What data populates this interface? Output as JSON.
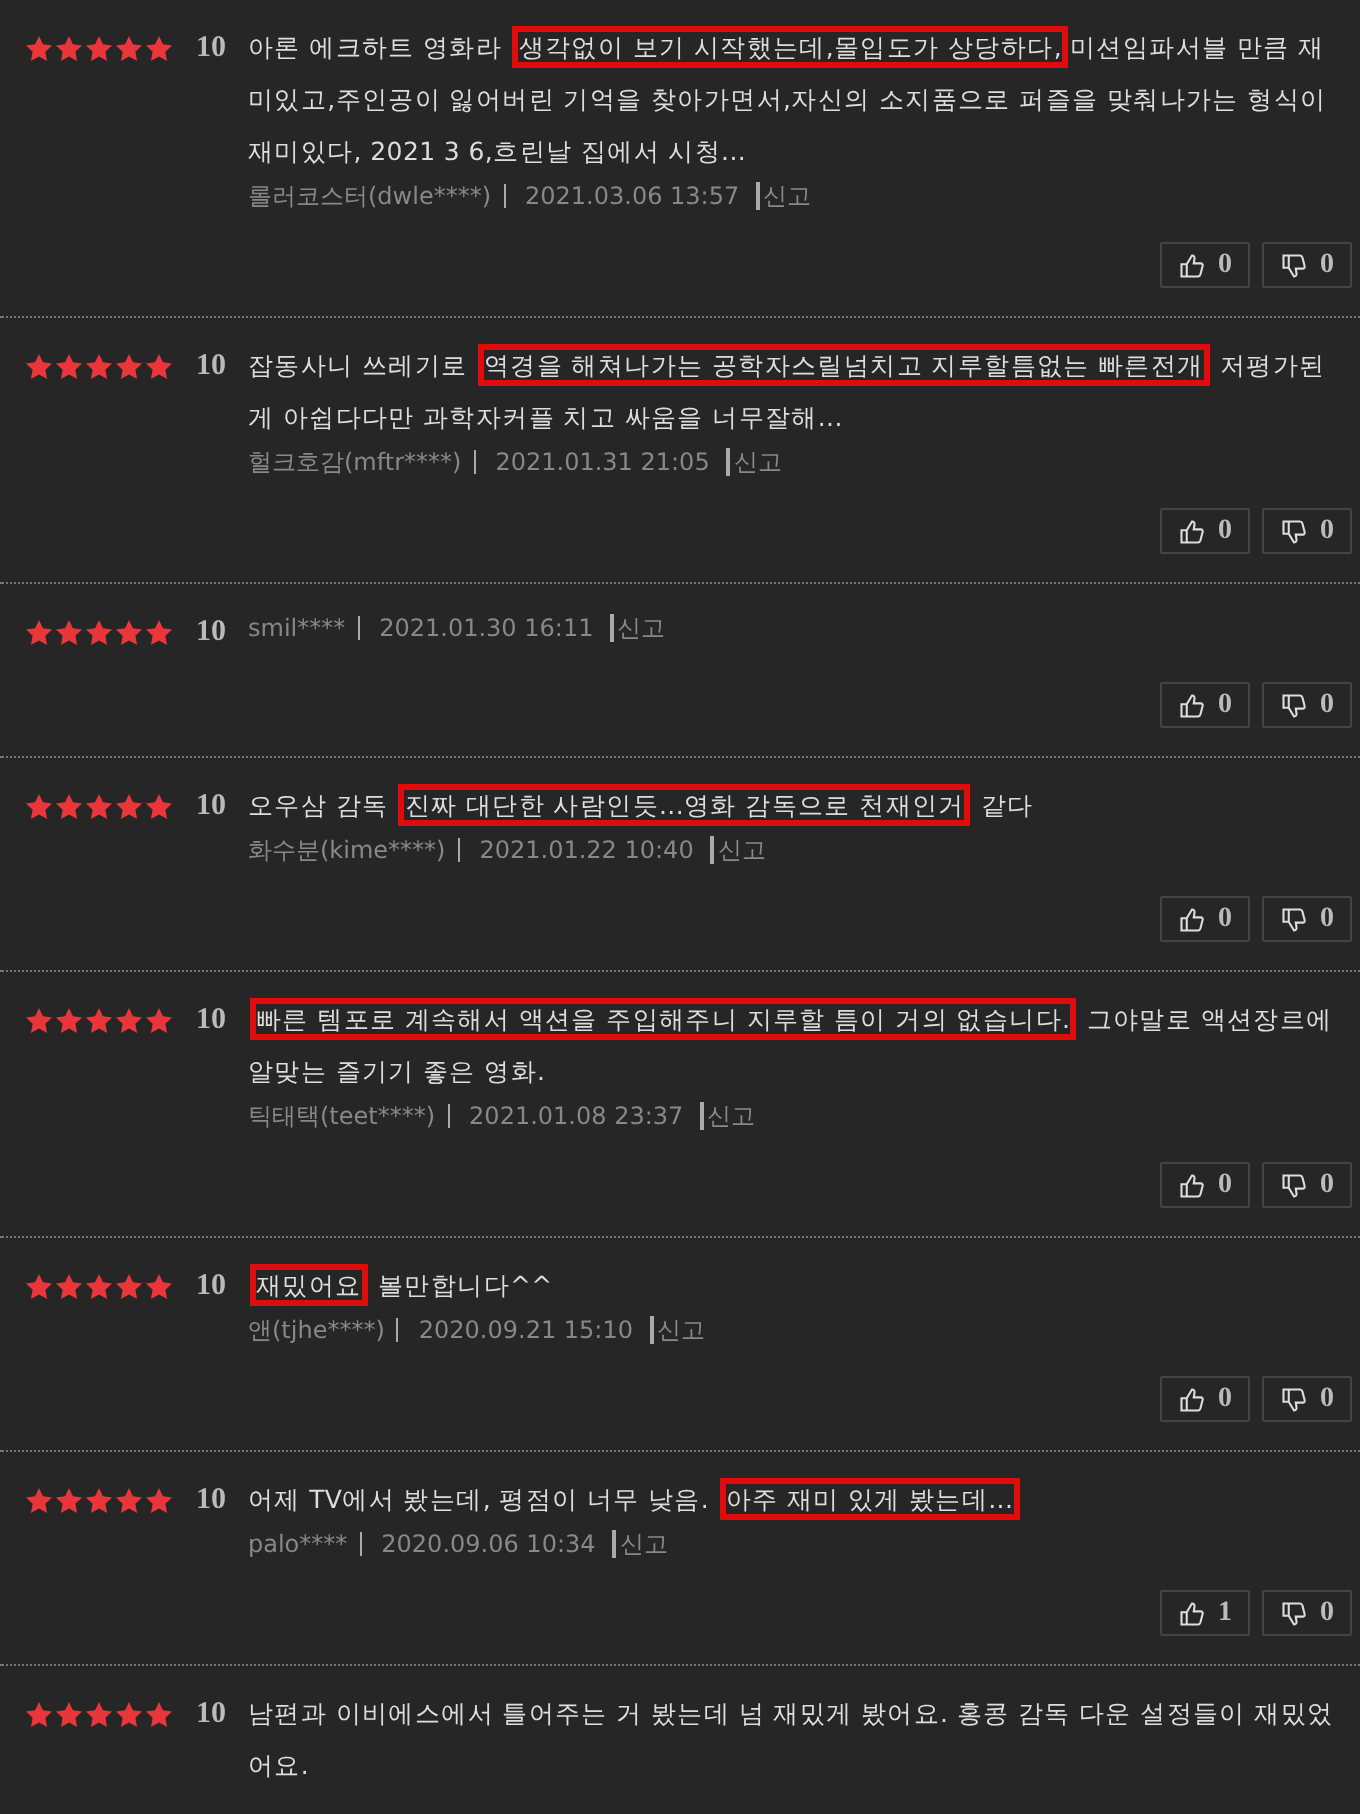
{
  "reviews": [
    {
      "stars": 5,
      "score": "10",
      "segments": [
        {
          "text": "아론 에크하트 영화라 ",
          "highlighted": false
        },
        {
          "text": "생각없이 보기 시작했는데,몰입도가 상당하다,",
          "highlighted": true
        },
        {
          "text": "미션임파서블 만큼 재미있고,주인공이 잃어버린 기억을 찾아가면서,자신의 소지품으로 퍼즐을 맞춰나가는 형식이 재미있다, 2021 3 6,흐린날 집에서 시청...",
          "highlighted": false
        }
      ],
      "author": "롤러코스터(dwle****)",
      "date": "2021.03.06 13:57",
      "report": "신고",
      "likes": "0",
      "dislikes": "0"
    },
    {
      "stars": 5,
      "score": "10",
      "segments": [
        {
          "text": "잡동사니 쓰레기로 ",
          "highlighted": false
        },
        {
          "text": "역경을 해쳐나가는 공학자스릴넘치고 지루할틈없는 빠른전개",
          "highlighted": true
        },
        {
          "text": " 저평가된게 아쉽다다만 과학자커플 치고 싸움을 너무잘해...",
          "highlighted": false
        }
      ],
      "author": "헐크호감(mftr****)",
      "date": "2021.01.31 21:05",
      "report": "신고",
      "likes": "0",
      "dislikes": "0"
    },
    {
      "stars": 5,
      "score": "10",
      "author": "smil****",
      "date": "2021.01.30 16:11",
      "report": "신고",
      "likes": "0",
      "dislikes": "0"
    },
    {
      "stars": 5,
      "score": "10",
      "segments": [
        {
          "text": "오우삼 감독 ",
          "highlighted": false
        },
        {
          "text": "진짜 대단한 사람인듯...영화 감독으로 천재인거",
          "highlighted": true
        },
        {
          "text": " 같다",
          "highlighted": false
        }
      ],
      "author": "화수분(kime****)",
      "date": "2021.01.22 10:40",
      "report": "신고",
      "likes": "0",
      "dislikes": "0"
    },
    {
      "stars": 5,
      "score": "10",
      "segments": [
        {
          "text": "빠른 템포로 계속해서 액션을 주입해주니 지루할 틈이 거의 없습니다.",
          "highlighted": true
        },
        {
          "text": " 그야말로 액션장르에 알맞는 즐기기 좋은 영화.",
          "highlighted": false
        }
      ],
      "author": "틱태택(teet****)",
      "date": "2021.01.08 23:37",
      "report": "신고",
      "likes": "0",
      "dislikes": "0"
    },
    {
      "stars": 5,
      "score": "10",
      "segments": [
        {
          "text": "재밌어요",
          "highlighted": true
        },
        {
          "text": " 볼만합니다^^",
          "highlighted": false
        }
      ],
      "author": "앤(tjhe****)",
      "date": "2020.09.21 15:10",
      "report": "신고",
      "likes": "0",
      "dislikes": "0"
    },
    {
      "stars": 5,
      "score": "10",
      "segments": [
        {
          "text": "어제 TV에서 봤는데, 평점이 너무 낮음. ",
          "highlighted": false
        },
        {
          "text": "아주 재미 있게 봤는데...",
          "highlighted": true
        }
      ],
      "author": "palo****",
      "date": "2020.09.06 10:34",
      "report": "신고",
      "likes": "1",
      "dislikes": "0"
    },
    {
      "stars": 5,
      "score": "10",
      "segments": [
        {
          "text": "남편과 이비에스에서 틀어주는 거 봤는데 넘 재밌게 봤어요. 홍콩 감독 다운 설정들이 재밌었어요.",
          "highlighted": false
        }
      ]
    }
  ]
}
